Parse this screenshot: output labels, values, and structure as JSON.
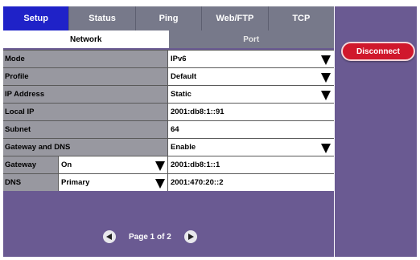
{
  "tabs": [
    "Setup",
    "Status",
    "Ping",
    "Web/FTP",
    "TCP"
  ],
  "subtabs": [
    "Network",
    "Port"
  ],
  "rows": {
    "mode": {
      "label": "Mode",
      "value": "IPv6"
    },
    "profile": {
      "label": "Profile",
      "value": "Default"
    },
    "ip_address": {
      "label": "IP Address",
      "value": "Static"
    },
    "local_ip": {
      "label": "Local IP",
      "value": "2001:db8:1::91"
    },
    "subnet": {
      "label": "Subnet",
      "value": "64"
    },
    "gateway_dns": {
      "label": "Gateway and DNS",
      "value": "Enable"
    },
    "gateway": {
      "label": "Gateway",
      "option": "On",
      "value": "2001:db8:1::1"
    },
    "dns": {
      "label": "DNS",
      "option": "Primary",
      "value": "2001:470:20::2"
    }
  },
  "pager": {
    "text": "Page 1 of 2"
  },
  "disconnect_label": "Disconnect",
  "colors": {
    "active_tab": "#1f22c8",
    "panel": "#6a5a92",
    "disconnect": "#d0182c"
  }
}
